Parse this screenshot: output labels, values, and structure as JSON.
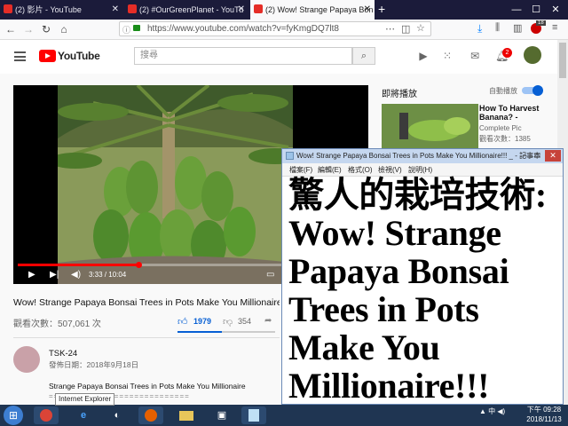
{
  "tabs": [
    {
      "title": "(2) 影片 - YouTube"
    },
    {
      "title": "(2) #OurGreenPlanet - YouTu"
    },
    {
      "title": "(2) Wow! Strange Papaya Bon"
    }
  ],
  "browser": {
    "url": "https://www.youtube.com/watch?v=fyKmgDQ7lt8",
    "ext_badge": "18"
  },
  "youtube": {
    "logo_text": "YouTube",
    "search_placeholder": "搜尋",
    "notification_count": "2"
  },
  "video": {
    "time": "3:33 / 10:04",
    "progress_fraction": 0.353,
    "title": "Wow! Strange Papaya Bonsai Trees in Pots Make You Millionaire!!!",
    "views": "觀看次數：507,061 次",
    "likes": "1979",
    "dislikes": "354",
    "channel": "TSK-24",
    "published": "發佈日期：2018年9月18日",
    "description": "Strange Papaya Bonsai Trees in Pots Make You Millionaire",
    "description_rule": "============================"
  },
  "sidebar": {
    "up_next": "即將播放",
    "autoplay": "自動播放",
    "next_title": "How To Harvest Banana? -",
    "next_channel": "Complete Pic",
    "next_views": "觀看次數：1385"
  },
  "notepad": {
    "title": "Wow! Strange Papaya Bonsai Trees in Pots Make You Millionaire!!! _ - 記事本",
    "menu": [
      "檔案(F)",
      "編輯(E)",
      "格式(O)",
      "檢視(V)",
      "說明(H)"
    ],
    "content": "驚人的栽培技術:\nWow! Strange\nPapaya Bonsai\nTrees in Pots\nMake You\nMillionaire!!!"
  },
  "taskbar": {
    "tooltip": "Internet Explorer",
    "tray_lang": "中",
    "time": "下午 09:28",
    "date": "2018/11/13"
  },
  "colors": {
    "yt_red": "#ff0000",
    "accent_blue": "#065fd4",
    "tabstrip": "#1b1b3a",
    "taskbar": "#1f3552"
  }
}
